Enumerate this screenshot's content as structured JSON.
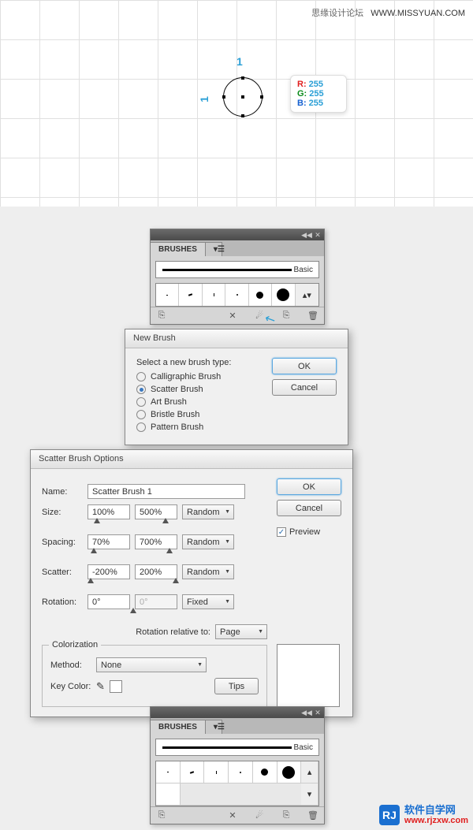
{
  "watermark_top": {
    "cn": "思缘设计论坛",
    "url": "WWW.MISSYUAN.COM"
  },
  "canvas": {
    "dim_w": "1",
    "dim_h": "1",
    "rgb": {
      "r_label": "R:",
      "g_label": "G:",
      "b_label": "B:",
      "r": "255",
      "g": "255",
      "b": "255"
    }
  },
  "brushes_panel": {
    "title": "BRUSHES",
    "brush_label": "Basic"
  },
  "new_brush": {
    "title": "New Brush",
    "prompt": "Select a new brush type:",
    "opts": [
      "Calligraphic Brush",
      "Scatter Brush",
      "Art Brush",
      "Bristle Brush",
      "Pattern Brush"
    ],
    "ok": "OK",
    "cancel": "Cancel"
  },
  "scatter": {
    "title": "Scatter Brush Options",
    "name_label": "Name:",
    "name_val": "Scatter Brush 1",
    "size_label": "Size:",
    "size_a": "100%",
    "size_b": "500%",
    "size_mode": "Random",
    "spacing_label": "Spacing:",
    "spacing_a": "70%",
    "spacing_b": "700%",
    "spacing_mode": "Random",
    "scatter_label": "Scatter:",
    "scatter_a": "-200%",
    "scatter_b": "200%",
    "scatter_mode": "Random",
    "rotation_label": "Rotation:",
    "rotation_a": "0°",
    "rotation_b": "0°",
    "rotation_mode": "Fixed",
    "rot_rel_label": "Rotation relative to:",
    "rot_rel_val": "Page",
    "colorization": "Colorization",
    "method_label": "Method:",
    "method_val": "None",
    "key_label": "Key Color:",
    "tips": "Tips",
    "ok": "OK",
    "cancel": "Cancel",
    "preview": "Preview"
  },
  "watermark_bottom": {
    "cn": "软件自学网",
    "url": "www.rjzxw.com",
    "logo": "RJ"
  }
}
